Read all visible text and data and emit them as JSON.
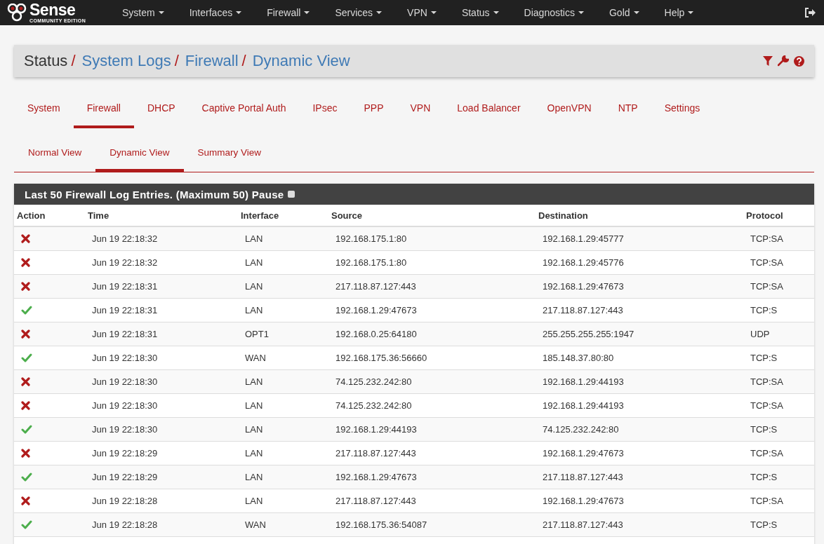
{
  "navbar": {
    "logo": {
      "word": "Sense",
      "edition": "COMMUNITY EDITION"
    },
    "menus": [
      "System",
      "Interfaces",
      "Firewall",
      "Services",
      "VPN",
      "Status",
      "Diagnostics",
      "Gold",
      "Help"
    ]
  },
  "breadcrumb": [
    {
      "label": "Status",
      "separator": "/"
    },
    {
      "label": "System Logs",
      "separator": "/"
    },
    {
      "label": "Firewall",
      "separator": "/"
    },
    {
      "label": "Dynamic View"
    }
  ],
  "tabs": [
    {
      "label": "System",
      "selected": false
    },
    {
      "label": "Firewall",
      "selected": true
    },
    {
      "label": "DHCP",
      "selected": false
    },
    {
      "label": "Captive Portal Auth",
      "selected": false
    },
    {
      "label": "IPsec",
      "selected": false
    },
    {
      "label": "PPP",
      "selected": false
    },
    {
      "label": "VPN",
      "selected": false
    },
    {
      "label": "Load Balancer",
      "selected": false
    },
    {
      "label": "OpenVPN",
      "selected": false
    },
    {
      "label": "NTP",
      "selected": false
    },
    {
      "label": "Settings",
      "selected": false
    }
  ],
  "subtabs": [
    {
      "label": "Normal View",
      "selected": false
    },
    {
      "label": "Dynamic View",
      "selected": true
    },
    {
      "label": "Summary View",
      "selected": false
    }
  ],
  "panel": {
    "title": "Last 50 Firewall Log Entries. (Maximum 50) Pause",
    "pause_checked": false,
    "columns": [
      "Action",
      "Time",
      "Interface",
      "Source",
      "Destination",
      "Protocol"
    ],
    "rows": [
      {
        "kind": "block",
        "time": "Jun 19 22:18:32",
        "interface": "LAN",
        "source": "192.168.175.1:80",
        "destination": "192.168.1.29:45777",
        "protocol": "TCP:SA"
      },
      {
        "kind": "block",
        "time": "Jun 19 22:18:32",
        "interface": "LAN",
        "source": "192.168.175.1:80",
        "destination": "192.168.1.29:45776",
        "protocol": "TCP:SA"
      },
      {
        "kind": "block",
        "time": "Jun 19 22:18:31",
        "interface": "LAN",
        "source": "217.118.87.127:443",
        "destination": "192.168.1.29:47673",
        "protocol": "TCP:SA"
      },
      {
        "kind": "pass",
        "time": "Jun 19 22:18:31",
        "interface": "LAN",
        "source": "192.168.1.29:47673",
        "destination": "217.118.87.127:443",
        "protocol": "TCP:S"
      },
      {
        "kind": "block",
        "time": "Jun 19 22:18:31",
        "interface": "OPT1",
        "source": "192.168.0.25:64180",
        "destination": "255.255.255.255:1947",
        "protocol": "UDP"
      },
      {
        "kind": "pass",
        "time": "Jun 19 22:18:30",
        "interface": "WAN",
        "source": "192.168.175.36:56660",
        "destination": "185.148.37.80:80",
        "protocol": "TCP:S"
      },
      {
        "kind": "block",
        "time": "Jun 19 22:18:30",
        "interface": "LAN",
        "source": "74.125.232.242:80",
        "destination": "192.168.1.29:44193",
        "protocol": "TCP:SA"
      },
      {
        "kind": "block",
        "time": "Jun 19 22:18:30",
        "interface": "LAN",
        "source": "74.125.232.242:80",
        "destination": "192.168.1.29:44193",
        "protocol": "TCP:SA"
      },
      {
        "kind": "pass",
        "time": "Jun 19 22:18:30",
        "interface": "LAN",
        "source": "192.168.1.29:44193",
        "destination": "74.125.232.242:80",
        "protocol": "TCP:S"
      },
      {
        "kind": "block",
        "time": "Jun 19 22:18:29",
        "interface": "LAN",
        "source": "217.118.87.127:443",
        "destination": "192.168.1.29:47673",
        "protocol": "TCP:SA"
      },
      {
        "kind": "pass",
        "time": "Jun 19 22:18:29",
        "interface": "LAN",
        "source": "192.168.1.29:47673",
        "destination": "217.118.87.127:443",
        "protocol": "TCP:S"
      },
      {
        "kind": "block",
        "time": "Jun 19 22:18:28",
        "interface": "LAN",
        "source": "217.118.87.127:443",
        "destination": "192.168.1.29:47673",
        "protocol": "TCP:SA"
      },
      {
        "kind": "pass",
        "time": "Jun 19 22:18:28",
        "interface": "WAN",
        "source": "192.168.175.36:54087",
        "destination": "217.118.87.127:443",
        "protocol": "TCP:S"
      }
    ]
  }
}
